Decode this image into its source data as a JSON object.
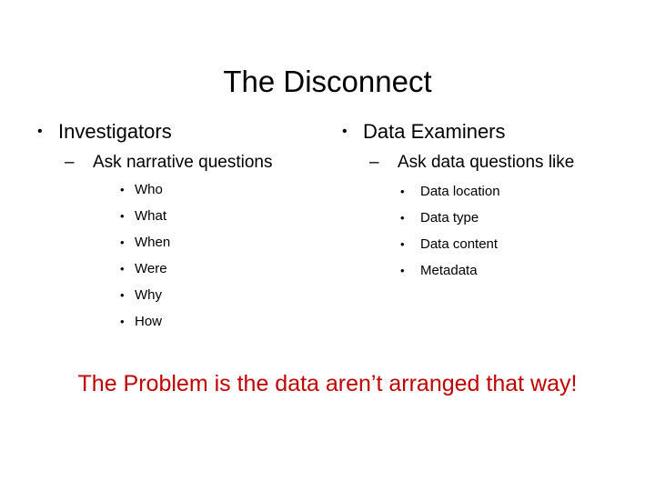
{
  "slide": {
    "title": "The Disconnect",
    "accent_color": "#C00000",
    "text_color": "#000000",
    "background_color": "#FFFFFF",
    "bullet_glyphs": {
      "level1": "•",
      "level2": "–",
      "level3": "•"
    },
    "columns": [
      {
        "heading": "Investigators",
        "subheading": "Ask narrative questions",
        "items": [
          "Who",
          "What",
          "When",
          "Were",
          "Why",
          "How"
        ]
      },
      {
        "heading": "Data Examiners",
        "subheading": "Ask data questions like",
        "items": [
          "Data location",
          "Data type",
          "Data content",
          "Metadata"
        ]
      }
    ],
    "closing_text": "The Problem is the data aren’t arranged that way!"
  }
}
